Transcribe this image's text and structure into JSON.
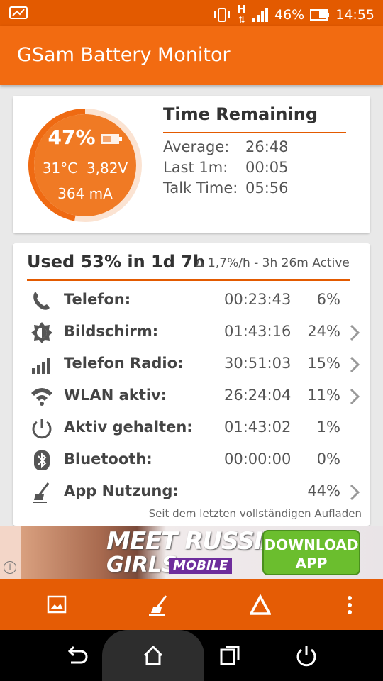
{
  "status_bar": {
    "network": "H",
    "battery": "46%",
    "time": "14:55"
  },
  "app": {
    "title": "GSam Battery Monitor"
  },
  "gauge": {
    "percent": "47%",
    "temperature": "31°C",
    "voltage": "3,82V",
    "current": "364 mA",
    "level": 0.47
  },
  "time_remaining": {
    "title": "Time Remaining",
    "rows": [
      {
        "label": "Average:",
        "value": "26:48"
      },
      {
        "label": "Last 1m:",
        "value": "00:05"
      },
      {
        "label": "Talk Time:",
        "value": "05:56"
      }
    ]
  },
  "usage": {
    "title": "Used 53% in 1d 7h",
    "subtitle": "Δ 1,7%/h - 3h 26m Active",
    "rows": [
      {
        "icon": "phone-icon",
        "name": "Telefon:",
        "time": "00:23:43",
        "percent": "6%",
        "chevron": false
      },
      {
        "icon": "brightness-icon",
        "name": "Bildschirm:",
        "time": "01:43:16",
        "percent": "24%",
        "chevron": true
      },
      {
        "icon": "signal-icon",
        "name": "Telefon Radio:",
        "time": "30:51:03",
        "percent": "15%",
        "chevron": true
      },
      {
        "icon": "wifi-icon",
        "name": "WLAN aktiv:",
        "time": "26:24:04",
        "percent": "11%",
        "chevron": true
      },
      {
        "icon": "power-icon",
        "name": "Aktiv gehalten:",
        "time": "01:43:02",
        "percent": "1%",
        "chevron": false
      },
      {
        "icon": "bluetooth-icon",
        "name": "Bluetooth:",
        "time": "00:00:00",
        "percent": "0%",
        "chevron": false
      },
      {
        "icon": "broom-icon",
        "name": "App Nutzung:",
        "time": "",
        "percent": "44%",
        "chevron": true
      }
    ],
    "footnote": "Seit dem letzten vollständigen Aufladen"
  },
  "ad": {
    "line1": "MEET RUSSIAN",
    "line2": "GIRLS",
    "badge": "MOBILE",
    "button_line1": "DOWNLOAD",
    "button_line2": "APP",
    "info": "i"
  },
  "colors": {
    "status_bar": "#e35a00",
    "app_bar": "#f26b11",
    "accent": "#e35a00",
    "gauge_fill": "#f07a24",
    "bottom_bar": "#e55c05"
  }
}
